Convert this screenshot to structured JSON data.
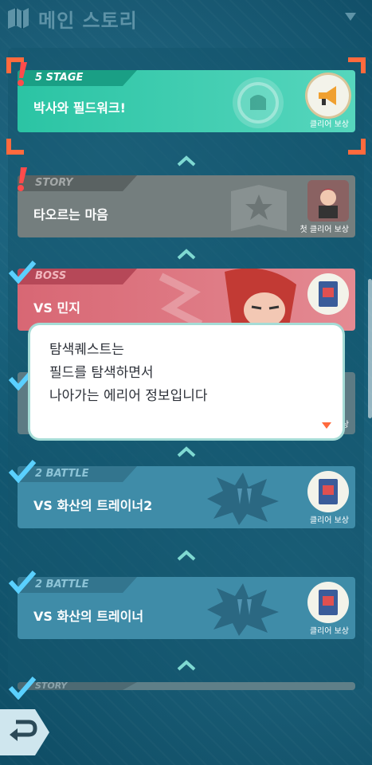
{
  "header": {
    "title": "메인 스토리",
    "icon": "journal-map-icon",
    "right_icon": "dropdown-triangle-icon"
  },
  "cards": [
    {
      "tag": "5 STAGE",
      "title": "박사와 필드워크!",
      "reward_label": "클리어 보상",
      "reward_icon": "megaphone-item-icon",
      "status": "new",
      "color": "#2cc6a6"
    },
    {
      "tag": "STORY",
      "title": "타오르는 마음",
      "reward_label": "첫 클리어 보상",
      "reward_icon": "trainer-portrait-icon",
      "status": "new",
      "color": "#707a7a"
    },
    {
      "tag": "BOSS",
      "title": "VS 민지",
      "reward_label": "",
      "reward_icon": "book-item-icon",
      "status": "cleared",
      "color": "#d96a78"
    },
    {
      "tag": "",
      "title": "",
      "reward_label": "상",
      "reward_icon": "",
      "status": "cleared",
      "color": "#5d7b84"
    },
    {
      "tag": "2 BATTLE",
      "title": "VS 화산의 트레이너2",
      "reward_label": "클리어 보상",
      "reward_icon": "book-item-icon",
      "status": "cleared",
      "color": "#3d8ba8"
    },
    {
      "tag": "2 BATTLE",
      "title": "VS 화산의 트레이너",
      "reward_label": "클리어 보상",
      "reward_icon": "book-item-icon",
      "status": "cleared",
      "color": "#3d8ba8"
    },
    {
      "tag": "STORY",
      "title": "",
      "reward_label": "",
      "reward_icon": "",
      "status": "cleared",
      "color": "#5f7f88"
    }
  ],
  "tooltip": {
    "lines": [
      "탐색퀘스트는",
      "필드를 탐색하면서",
      "나아가는 에리어 정보입니다"
    ]
  },
  "back_button": {
    "icon": "back-arrow-icon"
  },
  "colors": {
    "selection": "#ff6a3d",
    "check": "#5ad0ff",
    "exclaim": "#ff4b4b"
  }
}
